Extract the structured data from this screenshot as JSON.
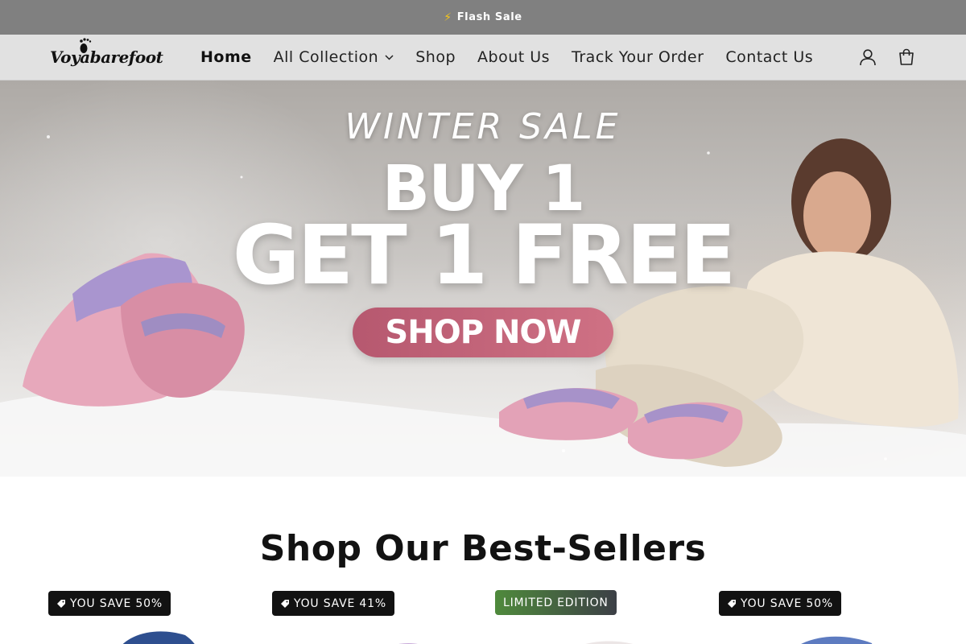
{
  "announcement": {
    "text": "Flash Sale",
    "icon": "lightning-bolt-icon"
  },
  "header": {
    "logo_text": "Voyabarefoot",
    "nav": [
      {
        "label": "Home",
        "active": true
      },
      {
        "label": "All Collection",
        "has_dropdown": true
      },
      {
        "label": "Shop"
      },
      {
        "label": "About Us"
      },
      {
        "label": "Track Your Order"
      },
      {
        "label": "Contact Us"
      }
    ],
    "icons": [
      "account-icon",
      "cart-icon"
    ]
  },
  "hero": {
    "subtitle": "WINTER SALE",
    "line1": "BUY 1",
    "line2": "GET 1 FREE",
    "cta": "SHOP NOW",
    "cta_color": "#c2637a"
  },
  "best_sellers": {
    "title": "Shop Our Best-Sellers",
    "products": [
      {
        "badge": "YOU SAVE 50%",
        "badge_type": "save",
        "shoe_color": "#2e4f8f"
      },
      {
        "badge": "YOU SAVE 41%",
        "badge_type": "save",
        "shoe_color": "#b9a0d6"
      },
      {
        "badge": "LIMITED EDITION",
        "badge_type": "limited",
        "shoe_color": "#e9e4e4"
      },
      {
        "badge": "YOU SAVE 50%",
        "badge_type": "save",
        "shoe_color": "#5d7bc0"
      }
    ]
  }
}
